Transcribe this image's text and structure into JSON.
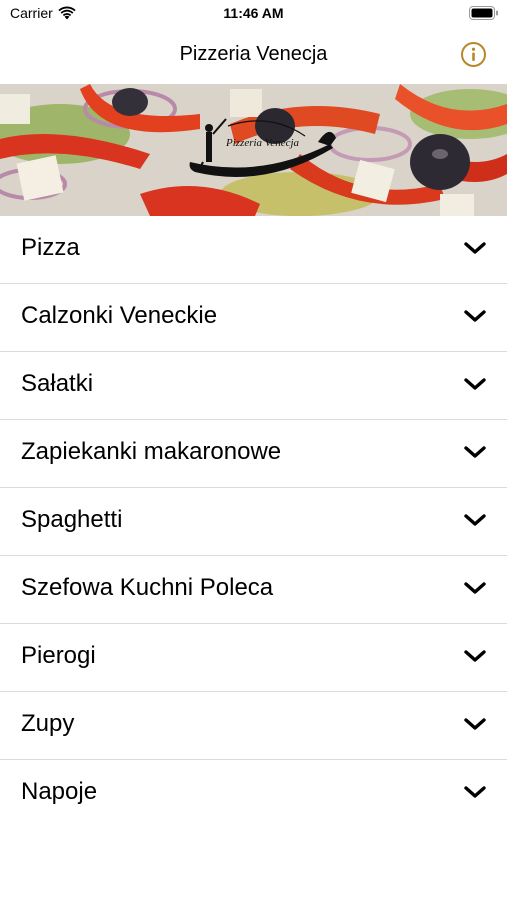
{
  "status_bar": {
    "carrier": "Carrier",
    "time": "11:46 AM"
  },
  "nav": {
    "title": "Pizzeria Venecja",
    "info_icon": "info-icon",
    "accent_color": "#b5892a"
  },
  "banner": {
    "logo_text": "Pizzeria Venecja"
  },
  "menu": {
    "items": [
      {
        "label": "Pizza"
      },
      {
        "label": "Calzonki Veneckie"
      },
      {
        "label": "Sałatki"
      },
      {
        "label": "Zapiekanki makaronowe"
      },
      {
        "label": "Spaghetti"
      },
      {
        "label": "Szefowa Kuchni Poleca"
      },
      {
        "label": "Pierogi"
      },
      {
        "label": "Zupy"
      },
      {
        "label": "Napoje"
      }
    ],
    "chevron_icon": "chevron-down-icon"
  }
}
